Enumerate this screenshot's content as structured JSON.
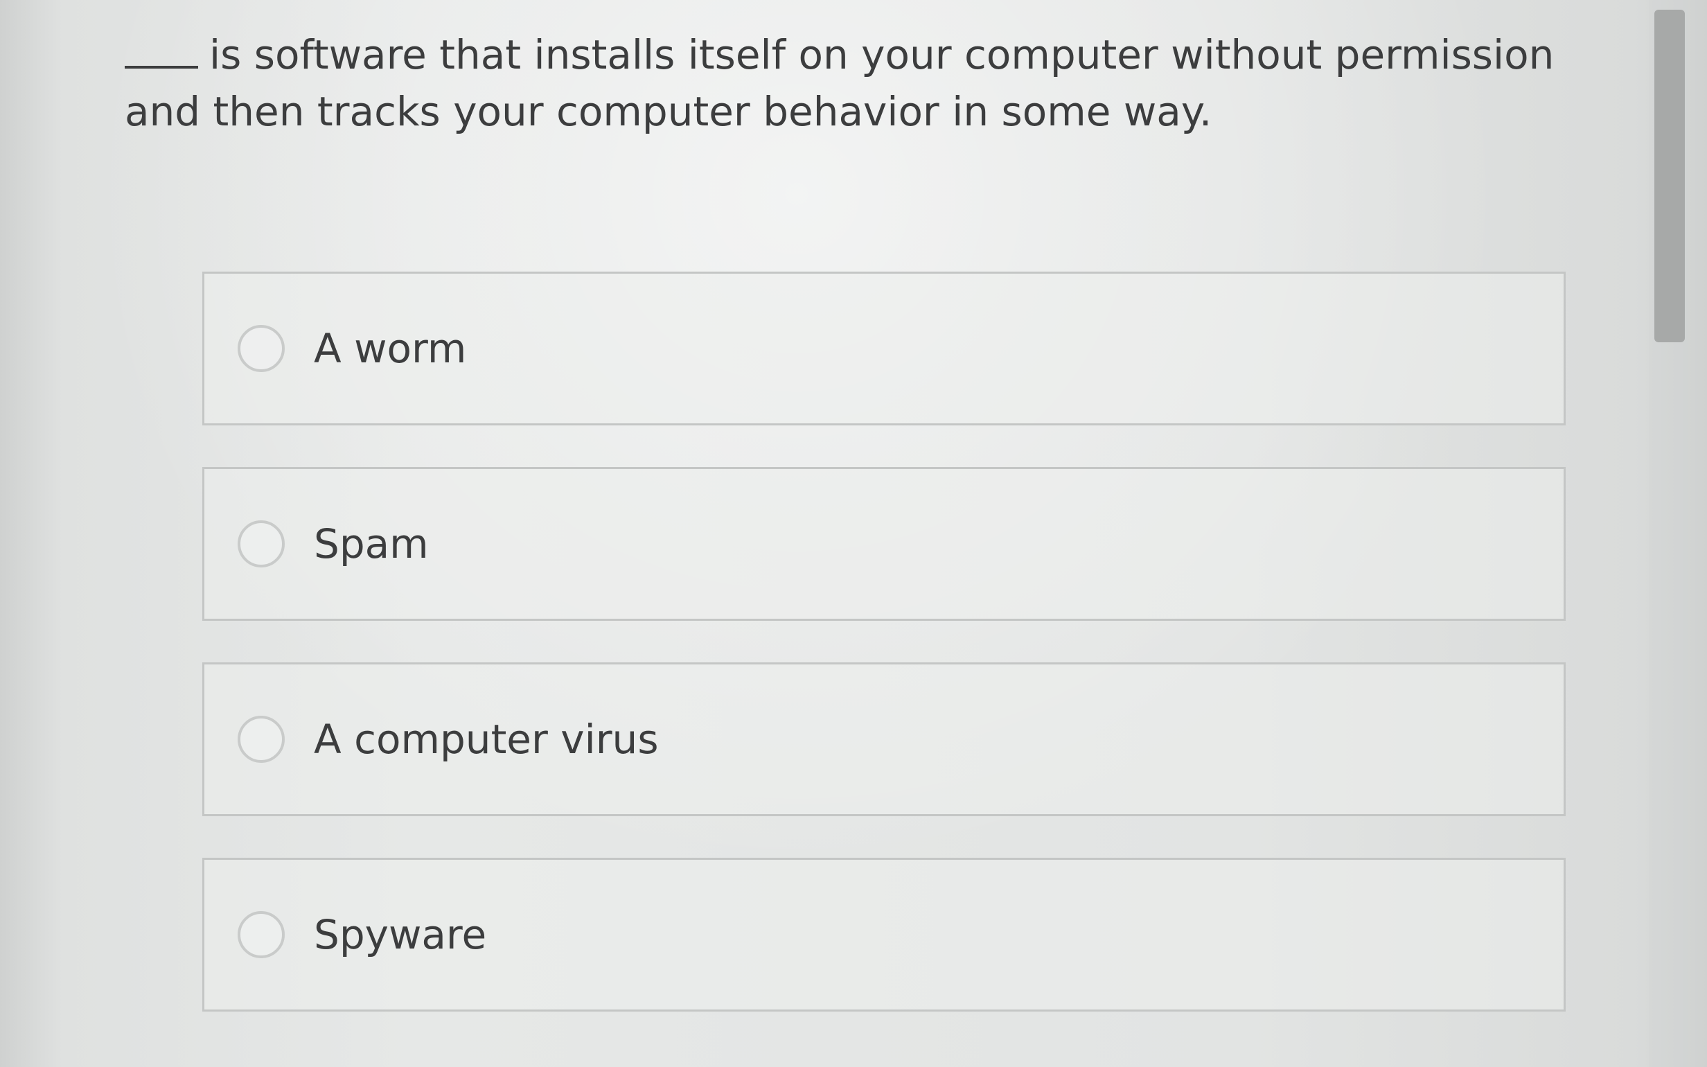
{
  "question": {
    "text": "is software that installs itself on your computer without permission and then tracks your computer behavior in some way."
  },
  "options": [
    {
      "label": "A worm"
    },
    {
      "label": "Spam"
    },
    {
      "label": "A computer virus"
    },
    {
      "label": "Spyware"
    }
  ],
  "colors": {
    "text": "#3c3d3e",
    "border": "#c4c6c5",
    "scrollbar": "#a7a9a8"
  }
}
